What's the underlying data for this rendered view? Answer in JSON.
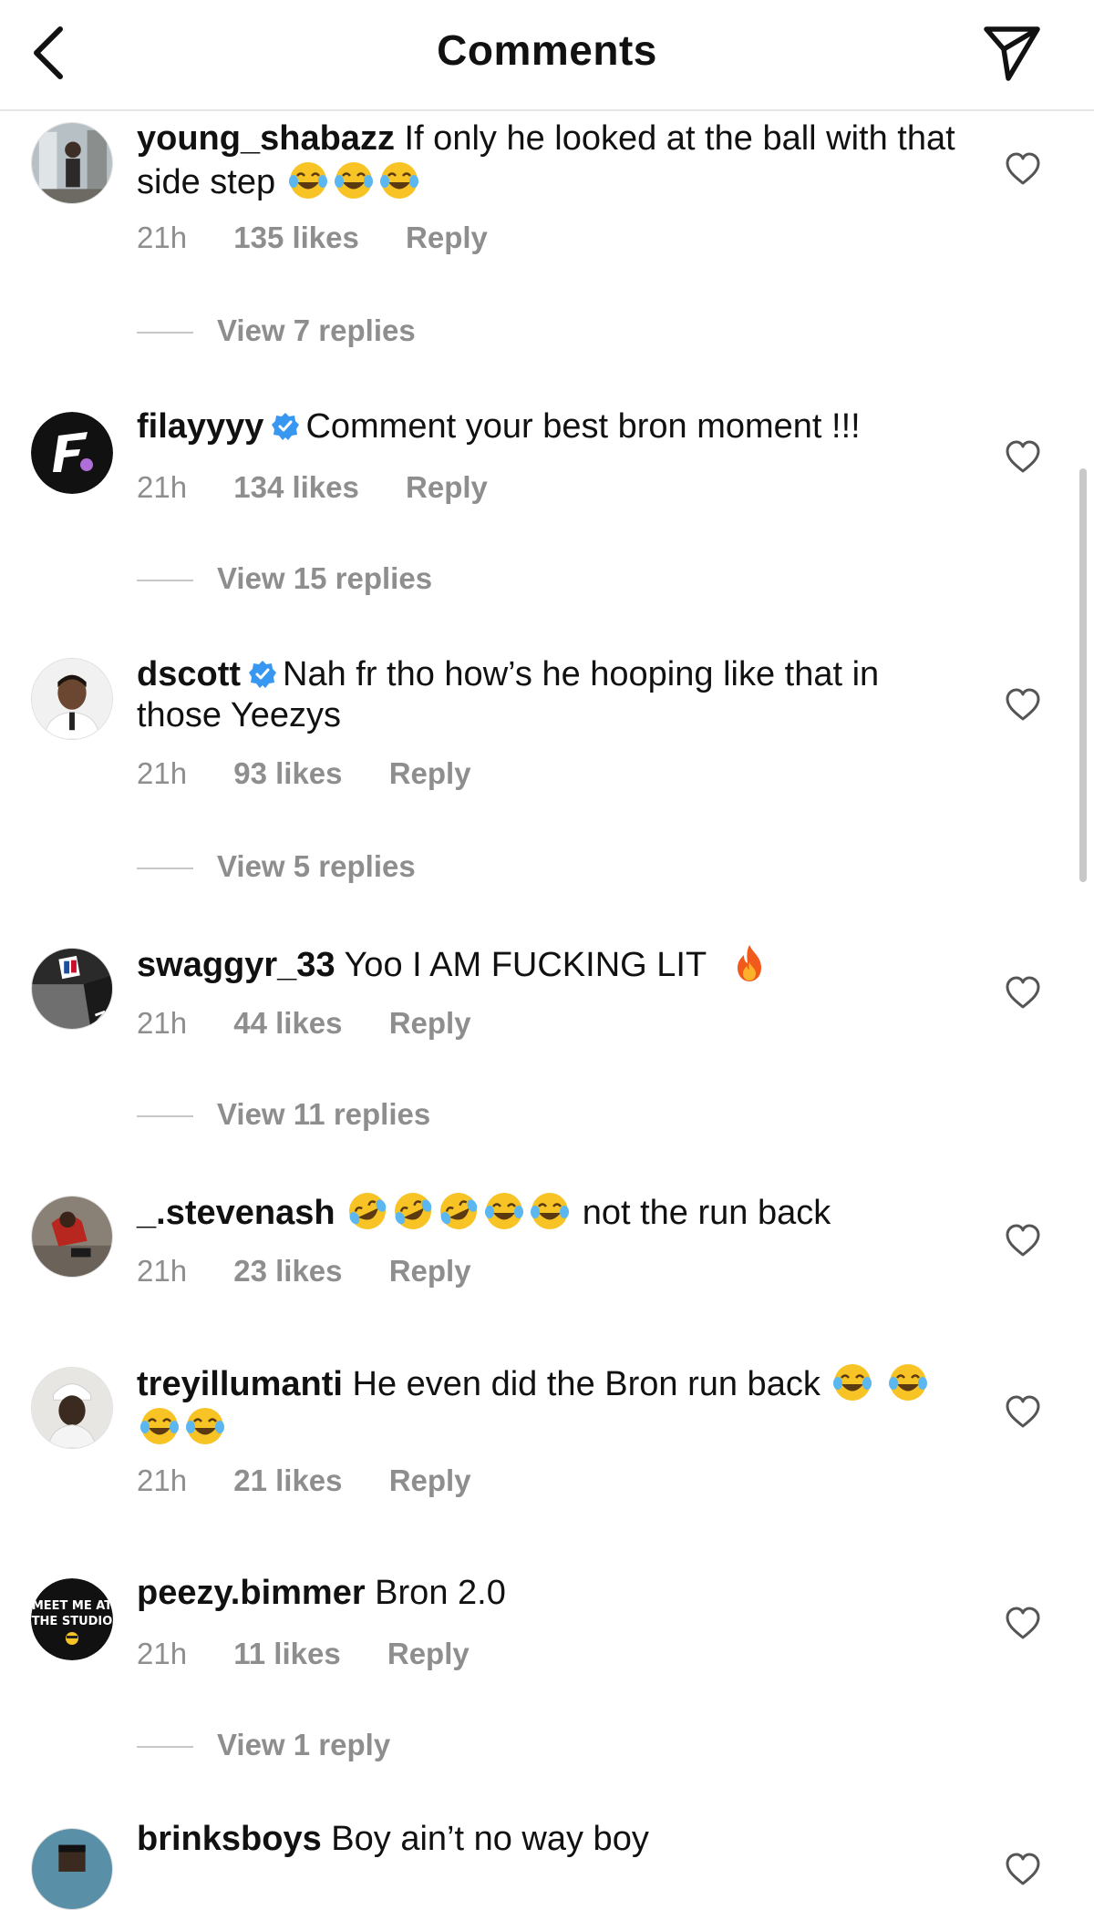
{
  "header": {
    "title": "Comments",
    "back_icon": "chevron-left-icon",
    "send_icon": "paper-plane-icon"
  },
  "colors": {
    "verified": "#3897f0",
    "meta_gray": "#8e8e8e"
  },
  "comments": [
    {
      "username": "young_shabazz",
      "verified": false,
      "text": " If only he looked at the ball with that side step",
      "emojis": [
        "tears-of-joy",
        "tears-of-joy",
        "tears-of-joy"
      ],
      "time": "21h",
      "likes": "135 likes",
      "reply": "Reply",
      "view_replies": "View 7 replies"
    },
    {
      "username": "filayyyy",
      "verified": true,
      "text": "Comment your best bron moment !!!",
      "time": "21h",
      "likes": "134 likes",
      "reply": "Reply",
      "view_replies": "View 15 replies"
    },
    {
      "username": "dscott",
      "verified": true,
      "text": "Nah fr tho how’s he hooping like that in those Yeezys",
      "time": "21h",
      "likes": "93 likes",
      "reply": "Reply",
      "view_replies": "View 5 replies"
    },
    {
      "username": "swaggyr_33",
      "verified": false,
      "text": " Yoo I AM FUCKING LIT",
      "emojis": [
        "fire"
      ],
      "time": "21h",
      "likes": "44 likes",
      "reply": "Reply",
      "view_replies": "View 11 replies"
    },
    {
      "username": "_.stevenash",
      "verified": false,
      "text": "not the run back",
      "emojis": [
        "rolling-laughing",
        "rolling-laughing",
        "rolling-laughing",
        "tears-of-joy",
        "tears-of-joy"
      ],
      "time": "21h",
      "likes": "23 likes",
      "reply": "Reply"
    },
    {
      "username": "treyillumanti",
      "verified": false,
      "text": " He even did the Bron run back",
      "emojis": [
        "tears-of-joy",
        "tears-of-joy",
        "tears-of-joy",
        "tears-of-joy"
      ],
      "time": "21h",
      "likes": "21 likes",
      "reply": "Reply"
    },
    {
      "username": "peezy.bimmer",
      "verified": false,
      "text": " Bron 2.0",
      "avatar_text": [
        "MEET ME AT",
        "THE STUDIO"
      ],
      "time": "21h",
      "likes": "11 likes",
      "reply": "Reply",
      "view_replies": "View 1 reply"
    },
    {
      "username": "brinksboys",
      "verified": false,
      "text": " Boy ain’t no way boy"
    }
  ]
}
